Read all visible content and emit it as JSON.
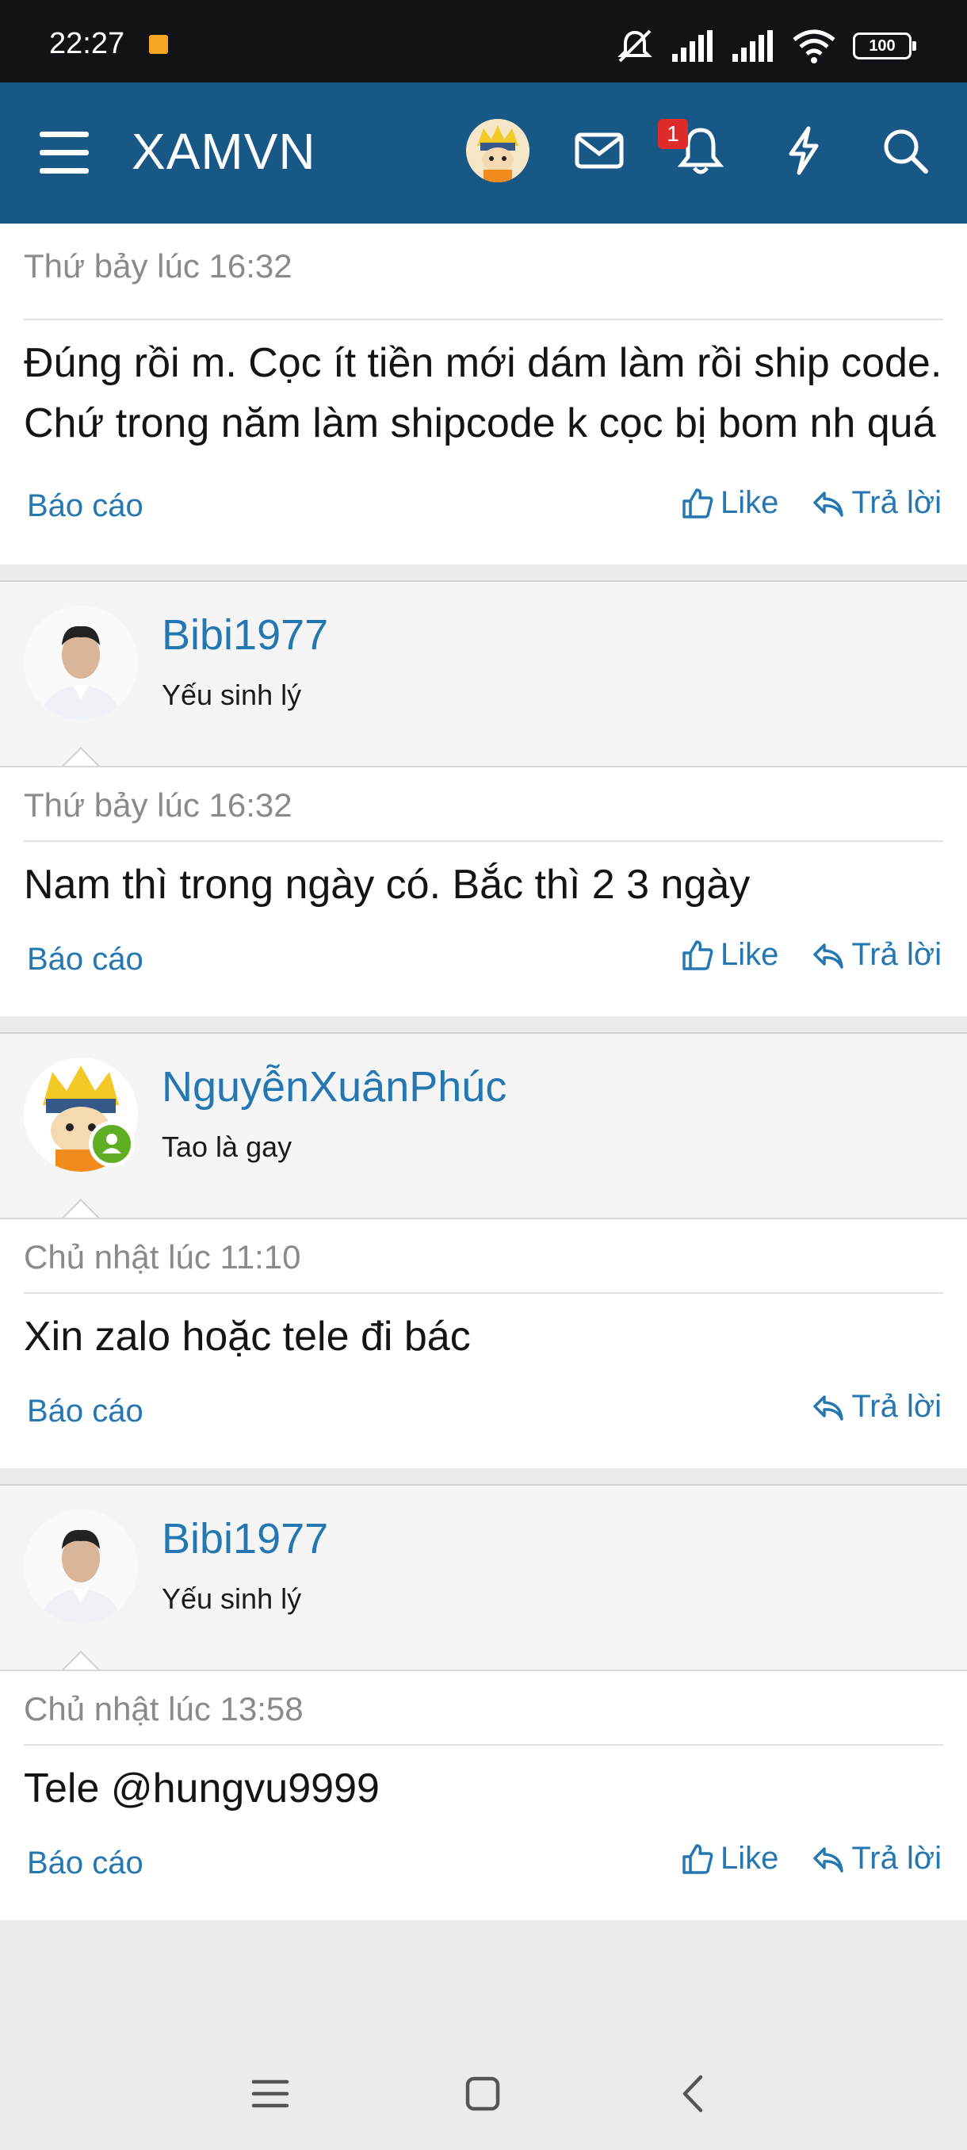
{
  "status_bar": {
    "time": "22:27",
    "battery": "100",
    "icons": [
      "mute-icon",
      "signal-icon",
      "signal-icon",
      "wifi-icon",
      "battery-icon"
    ]
  },
  "header": {
    "title": "XAMVN",
    "notification_count": "1"
  },
  "posts": [
    {
      "timestamp": "Thứ bảy lúc 16:32",
      "message": "Đúng rồi m. Cọc ít tiền mới dám làm rồi ship code. Chứ trong năm làm shipcode k cọc bị bom nh quá",
      "report": "Báo cáo",
      "like": "Like",
      "reply": "Trả lời"
    },
    {
      "user": "Bibi1977",
      "user_title": "Yếu sinh lý",
      "timestamp": "Thứ bảy lúc 16:32",
      "message": "Nam thì trong ngày có. Bắc thì 2 3 ngày",
      "report": "Báo cáo",
      "like": "Like",
      "reply": "Trả lời"
    },
    {
      "user": "NguyễnXuânPhúc",
      "user_title": "Tao là gay",
      "timestamp": "Chủ nhật lúc 11:10",
      "message": "Xin zalo hoặc tele đi bác",
      "report": "Báo cáo",
      "reply": "Trả lời"
    },
    {
      "user": "Bibi1977",
      "user_title": "Yếu sinh lý",
      "timestamp": "Chủ nhật lúc 13:58",
      "message": "Tele @hungvu9999",
      "report": "Báo cáo",
      "like": "Like",
      "reply": "Trả lời"
    }
  ],
  "colors": {
    "header_bg": "#185886",
    "link": "#2577b1",
    "online": "#5fae24",
    "badge": "#e02b2b"
  }
}
